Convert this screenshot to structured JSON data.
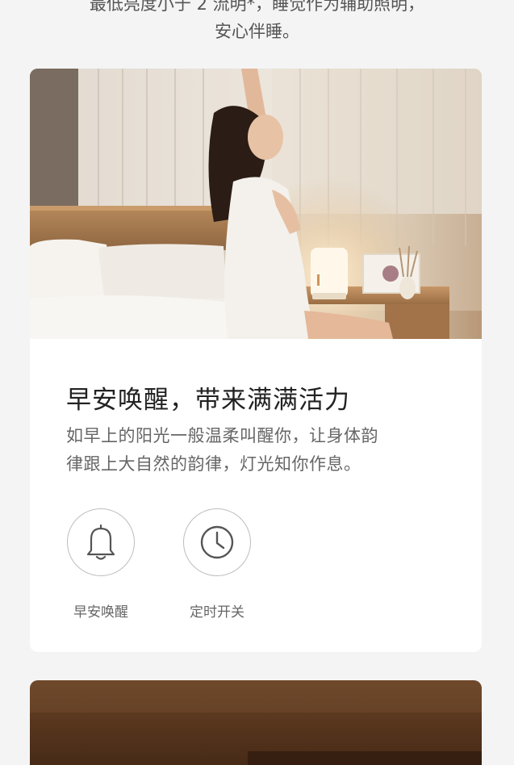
{
  "intro": {
    "line1": "最低亮度小于 2 流明*，睡觉作为辅助照明，",
    "line2": "安心伴睡。"
  },
  "card": {
    "title": "早安唤醒，带来满满活力",
    "description_line1": "如早上的阳光一般温柔叫醒你，让身体韵",
    "description_line2": "律跟上大自然的韵律，灯光知你作息。",
    "features": [
      {
        "label": "早安唤醒",
        "icon": "bell-icon"
      },
      {
        "label": "定时开关",
        "icon": "clock-icon"
      }
    ]
  },
  "colors": {
    "background": "#f4f4f4",
    "card": "#ffffff",
    "title": "#222222",
    "text": "#666666",
    "icon": "#555555",
    "icon_ring": "#bdbdbd"
  }
}
